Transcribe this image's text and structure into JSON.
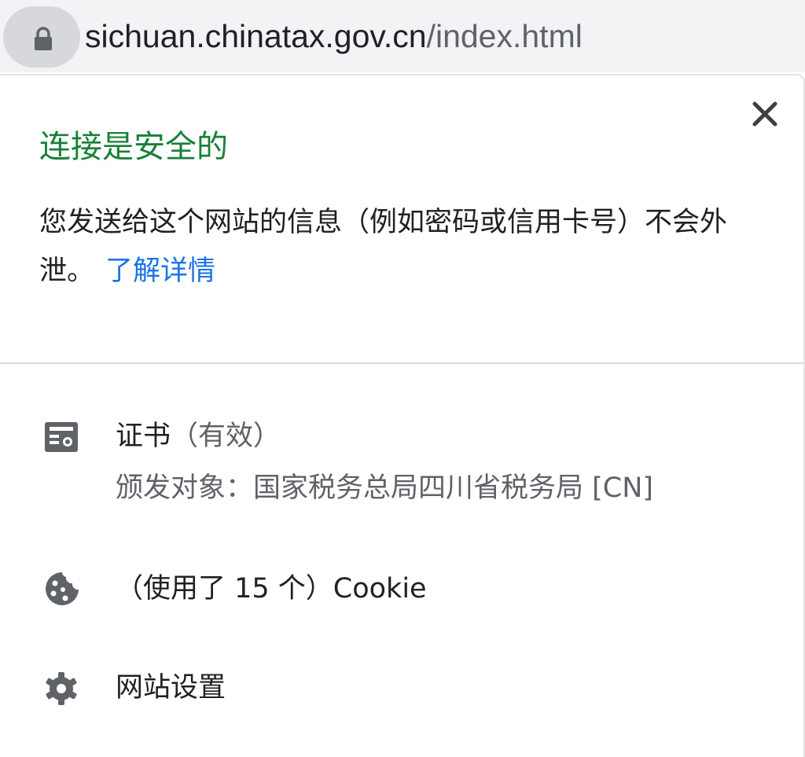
{
  "address_bar": {
    "url_host": "sichuan.chinatax.gov.cn",
    "url_path": "/index.html",
    "lock_icon": "lock-icon"
  },
  "popup": {
    "title": "连接是安全的",
    "description": "您发送给这个网站的信息（例如密码或信用卡号）不会外泄。",
    "learn_more": "了解详情",
    "close_icon": "close-icon",
    "certificate": {
      "icon": "certificate-icon",
      "label": "证书",
      "status": "（有效）",
      "issued_to": "颁发对象：国家税务总局四川省税务局 [CN]"
    },
    "cookies": {
      "icon": "cookie-icon",
      "label": "（使用了 15 个）Cookie"
    },
    "site_settings": {
      "icon": "gear-icon",
      "label": "网站设置"
    }
  },
  "colors": {
    "secure_green": "#188038",
    "link_blue": "#1a73e8",
    "text": "#202124",
    "secondary_text": "#5f6368"
  }
}
